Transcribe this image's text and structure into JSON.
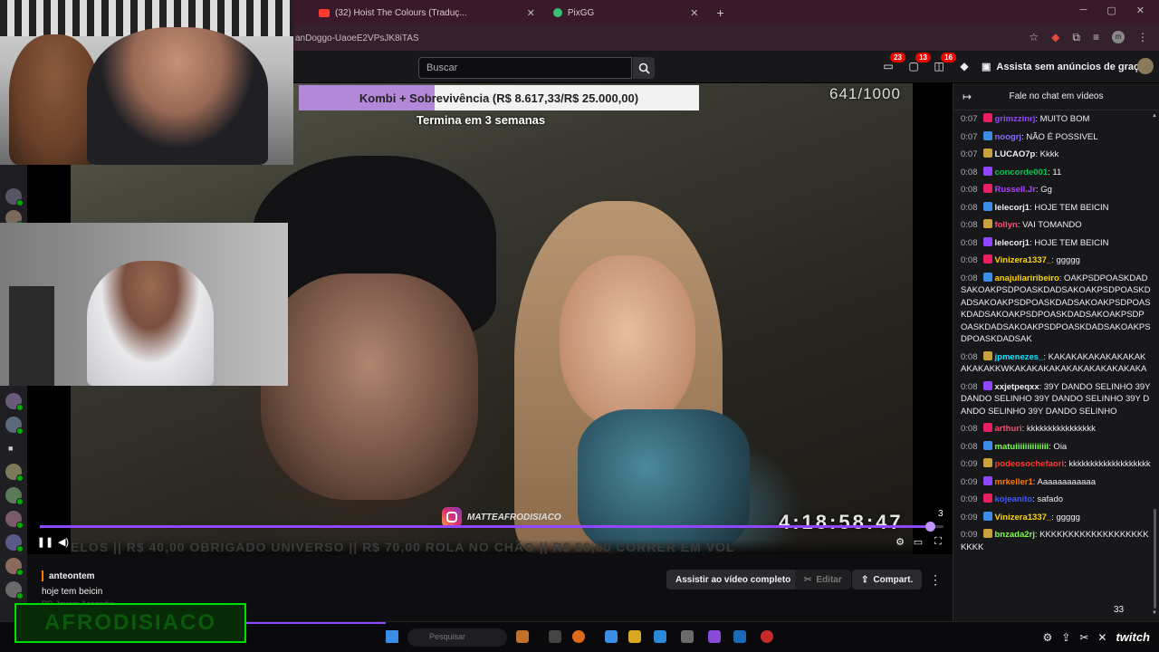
{
  "browser": {
    "tabs": [
      {
        "label": "(32) Hoist The Colours (Traduç...",
        "icon": "youtube-icon"
      },
      {
        "label": "PixGG",
        "icon": "pixgg-icon"
      }
    ],
    "url": "anDoggo-UaoeE2VPsJK8iTAS"
  },
  "nav": {
    "search_placeholder": "Buscar",
    "badges": {
      "inbox": "23",
      "whispers": "13",
      "notifications": "16"
    },
    "prime_label": "Assista sem anúncios de graça"
  },
  "video": {
    "goal_text": "Kombi + Sobrevivência (R$ 8.617,33/R$ 25.000,00)",
    "goal_sub": "Termina em 3 semanas",
    "goal_progress": 0.34,
    "counter": "641/1000",
    "timer": "4:18:58:47",
    "watermark": "MATTEAFRODISIACO",
    "ticker": "ELOS   ||   R$ 40,00 OBRIGADO UNIVERSO   ||   R$ 70,00 ROLA NO CHÃO   ||   R$ 50,00 CORRER EM VOL",
    "viewers": "3",
    "playback_progress": 0.985
  },
  "clip": {
    "author": "anteontem",
    "title": "hoje tem beicin",
    "subtitle": "PD Jovem Acessdia",
    "watch_full": "Assistir ao vídeo completo",
    "edit": "Editar",
    "share": "Compart."
  },
  "chat": {
    "header": "Fale no chat em vídeos",
    "footer_count": "33",
    "messages": [
      {
        "time": "0:07",
        "user": "grimzzinrj",
        "color": "#9147ff",
        "text": ": MUITO BOM"
      },
      {
        "time": "0:07",
        "user": "noogrj",
        "color": "#8a6cff",
        "text": ": NÃO É POSSIVEL"
      },
      {
        "time": "0:07",
        "user": "LUCAO7p",
        "color": "#efeff1",
        "text": ": Kkkk"
      },
      {
        "time": "0:08",
        "user": "concorde001",
        "color": "#00c853",
        "text": ": 11"
      },
      {
        "time": "0:08",
        "user": "Russell.Jr",
        "color": "#b040ff",
        "text": ": Gg"
      },
      {
        "time": "0:08",
        "user": "lelecorj1",
        "color": "#efeff1",
        "text": ": HOJE TEM BEICIN"
      },
      {
        "time": "0:08",
        "user": "follyn",
        "color": "#ff4b6e",
        "text": ": VAI TOMANDO"
      },
      {
        "time": "0:08",
        "user": "lelecorj1",
        "color": "#efeff1",
        "text": ": HOJE TEM BEICIN"
      },
      {
        "time": "0:08",
        "user": "Vinizera1337_",
        "color": "#ffd600",
        "text": ": ggggg"
      },
      {
        "time": "0:08",
        "user": "anajuliariribeiro",
        "color": "#ffd600",
        "text": ": OAKPSDPOASKDADSAKOAKPSDPOASKDADSAKOAKPSDPOASKDADSAKOAKPSDPOASKDADSAKOAKPSDPOASKDADSAKOAKPSDPOASKDADSAKOAKPSDPOASKDADSAKOAKPSDPOASKDADSAKOAKPSDPOASKDADSAK"
      },
      {
        "time": "0:08",
        "user": "jpmenezes_",
        "color": "#00e5ff",
        "text": ": KAKAKAKAKAKAKAKAKAKAKAKKWKAKAKAKAKAKAKAKAKAKAKAKA"
      },
      {
        "time": "0:08",
        "user": "xxjetpeqxx",
        "color": "#efeff1",
        "text": ": 39Y DANDO SELINHO 39Y DANDO SELINHO 39Y DANDO SELINHO 39Y DANDO SELINHO 39Y DANDO SELINHO"
      },
      {
        "time": "0:08",
        "user": "arthuri",
        "color": "#ff4b6e",
        "text": ": kkkkkkkkkkkkkkkk"
      },
      {
        "time": "0:08",
        "user": "matuiiiiiiiiiiiiii",
        "color": "#7cff4b",
        "text": ": Oia"
      },
      {
        "time": "0:09",
        "user": "podeosochefaori",
        "color": "#ff3b30",
        "text": ": kkkkkkkkkkkkkkkkkkk"
      },
      {
        "time": "0:09",
        "user": "mrkeller1",
        "color": "#ff7a00",
        "text": ": Aaaaaaaaaaaa"
      },
      {
        "time": "0:09",
        "user": "kojeanito",
        "color": "#3b5bff",
        "text": ": safado"
      },
      {
        "time": "0:09",
        "user": "Vinizera1337_",
        "color": "#ffd600",
        "text": ": ggggg"
      },
      {
        "time": "0:09",
        "user": "bnzada2rj",
        "color": "#7cff4b",
        "text": ": KKKKKKKKKKKKKKKKKKKKKKK"
      }
    ]
  },
  "taskbar": {
    "search_placeholder": "Pesquisar",
    "greenbox_text": "AFRODISIACO",
    "logo_text": "twitch"
  },
  "colors": {
    "accent": "#9147ff",
    "badge": "#eb0400",
    "bg": "#0e0e10"
  }
}
